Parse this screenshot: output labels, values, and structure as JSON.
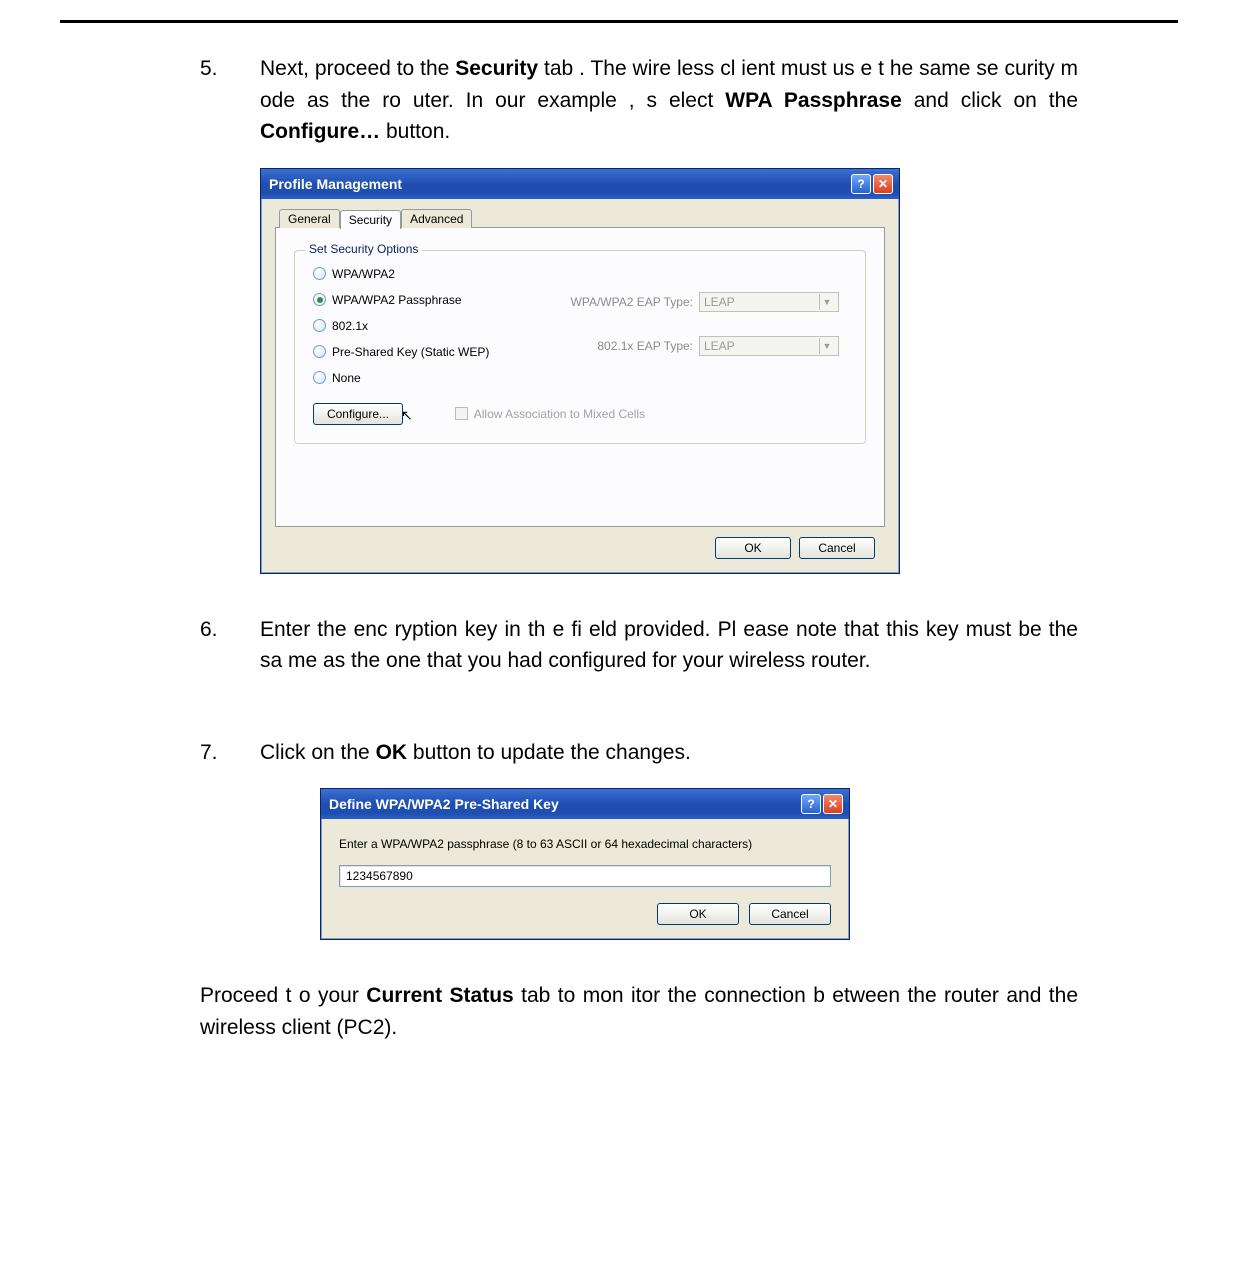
{
  "steps": {
    "s5": {
      "num": "5.",
      "text_pre": "Next, proceed  to the  ",
      "bold1": "Security",
      "text_mid1": " tab . The  wire less cl ient must us e t he same se curity m ode as the   ro uter. In our example    , s elect  ",
      "bold2": "WPA Passphrase",
      "text_mid2": " and click on the ",
      "bold3": "Configure…",
      "text_after": " button."
    },
    "s6": {
      "num": "6.",
      "text": "Enter the enc ryption key in th e fi eld provided. Pl ease note that this key must be the sa me as the one  that you had configured for  your wireless router."
    },
    "s7": {
      "num": "7.",
      "text_pre": "Click on the ",
      "bold1": "OK",
      "text_after": " button to update the changes."
    }
  },
  "paragraph": {
    "text_pre": "Proceed t o your ",
    "bold1": "Current Status",
    "text_after": " tab to mon itor the  connection b etween the router and the wireless client (PC2)."
  },
  "dialog1": {
    "title": "Profile Management",
    "help": "?",
    "close": "✕",
    "tabs": {
      "general": "General",
      "security": "Security",
      "advanced": "Advanced"
    },
    "group_legend": "Set Security Options",
    "radios": {
      "r1": "WPA/WPA2",
      "r2": "WPA/WPA2 Passphrase",
      "r3": "802.1x",
      "r4": "Pre-Shared Key (Static WEP)",
      "r5": "None"
    },
    "eap1_label": "WPA/WPA2 EAP Type:",
    "eap1_value": "LEAP",
    "eap2_label": "802.1x EAP Type:",
    "eap2_value": "LEAP",
    "configure_btn": "Configure...",
    "mixed_cells": "Allow Association to Mixed Cells",
    "ok": "OK",
    "cancel": "Cancel"
  },
  "dialog2": {
    "title": "Define WPA/WPA2 Pre-Shared Key",
    "help": "?",
    "close": "✕",
    "label": "Enter a WPA/WPA2 passphrase (8 to 63 ASCII or 64 hexadecimal characters)",
    "value": "1234567890",
    "ok": "OK",
    "cancel": "Cancel"
  }
}
